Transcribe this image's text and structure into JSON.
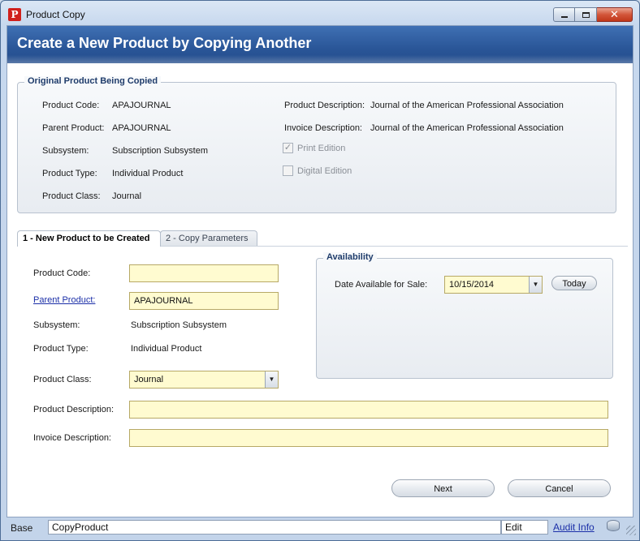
{
  "window": {
    "title": "Product Copy",
    "close_glyph": "✕"
  },
  "header": {
    "title": "Create a New Product by Copying Another"
  },
  "original": {
    "legend": "Original Product Being Copied",
    "product_code_label": "Product Code:",
    "product_code": "APAJOURNAL",
    "parent_product_label": "Parent Product:",
    "parent_product": "APAJOURNAL",
    "subsystem_label": "Subsystem:",
    "subsystem": "Subscription Subsystem",
    "product_type_label": "Product Type:",
    "product_type": "Individual Product",
    "product_class_label": "Product Class:",
    "product_class": "Journal",
    "product_description_label": "Product Description:",
    "product_description": "Journal of the American Professional Association",
    "invoice_description_label": "Invoice Description:",
    "invoice_description": "Journal of the American Professional Association",
    "print_edition_label": "Print Edition",
    "print_edition_checked": true,
    "print_edition_mark": "✓",
    "digital_edition_label": "Digital Edition",
    "digital_edition_checked": false
  },
  "tabs": [
    {
      "label": "1 - New Product to be Created",
      "active": true
    },
    {
      "label": "2 - Copy Parameters",
      "active": false
    }
  ],
  "form": {
    "product_code_label": "Product Code:",
    "product_code_value": "",
    "parent_product_label": "Parent Product:",
    "parent_product_value": "APAJOURNAL",
    "subsystem_label": "Subsystem:",
    "subsystem_value": "Subscription Subsystem",
    "product_type_label": "Product Type:",
    "product_type_value": "Individual Product",
    "product_class_label": "Product Class:",
    "product_class_value": "Journal",
    "product_description_label": "Product Description:",
    "product_description_value": "",
    "invoice_description_label": "Invoice Description:",
    "invoice_description_value": ""
  },
  "availability": {
    "legend": "Availability",
    "date_label": "Date Available for Sale:",
    "date_value": "10/15/2014",
    "today_button": "Today"
  },
  "buttons": {
    "next": "Next",
    "cancel": "Cancel"
  },
  "status_bar": {
    "base": "Base",
    "form_name": "CopyProduct",
    "mode": "Edit",
    "audit_info": "Audit Info"
  },
  "icons": {
    "dropdown": "▼"
  },
  "colors": {
    "banner": "#2a5698",
    "required_field": "#fffbd0",
    "link": "#1b2fa8"
  }
}
